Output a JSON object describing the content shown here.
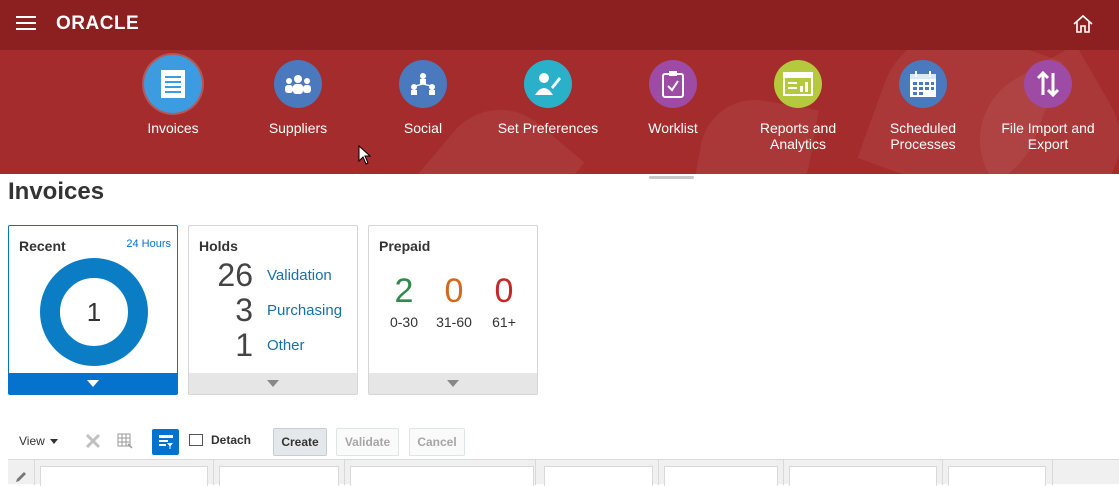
{
  "topbar": {
    "logo": "ORACLE",
    "menu_icon": "hamburger-icon",
    "home_icon": "home-icon"
  },
  "springboard": {
    "tiles": [
      {
        "label": "Invoices",
        "icon": "invoice-document-icon",
        "color": "#3d9be0",
        "selected": true
      },
      {
        "label": "Suppliers",
        "icon": "group-icon",
        "color": "#4b79be"
      },
      {
        "label": "Social",
        "icon": "network-icon",
        "color": "#4b79be"
      },
      {
        "label": "Set Preferences",
        "icon": "user-edit-icon",
        "color": "#2ab1c9"
      },
      {
        "label": "Worklist",
        "icon": "clipboard-check-icon",
        "color": "#9e4ba6"
      },
      {
        "label": "Reports and Analytics",
        "icon": "report-icon",
        "color": "#b5c93e"
      },
      {
        "label": "Scheduled Processes",
        "icon": "calendar-icon",
        "color": "#4b79be"
      },
      {
        "label": "File Import and Export",
        "icon": "import-export-icon",
        "color": "#9e4ba6"
      }
    ]
  },
  "page": {
    "title": "Invoices"
  },
  "infolets": {
    "recent": {
      "title": "Recent",
      "period": "24 Hours",
      "count": "1"
    },
    "holds": {
      "title": "Holds",
      "rows": [
        {
          "count": "26",
          "label": "Validation"
        },
        {
          "count": "3",
          "label": "Purchasing"
        },
        {
          "count": "1",
          "label": "Other"
        }
      ]
    },
    "prepaid": {
      "title": "Prepaid",
      "buckets": [
        {
          "count": "2",
          "range": "0-30",
          "color": "#2e8b4a"
        },
        {
          "count": "0",
          "range": "31-60",
          "color": "#d2691e"
        },
        {
          "count": "0",
          "range": "61+",
          "color": "#c62828"
        }
      ]
    }
  },
  "toolbar": {
    "view_label": "View",
    "detach_label": "Detach",
    "create_label": "Create",
    "validate_label": "Validate",
    "cancel_label": "Cancel"
  },
  "colors": {
    "topbar": "#8c1f1f",
    "springboard": "#a52c2c",
    "accent": "#0572ce"
  }
}
